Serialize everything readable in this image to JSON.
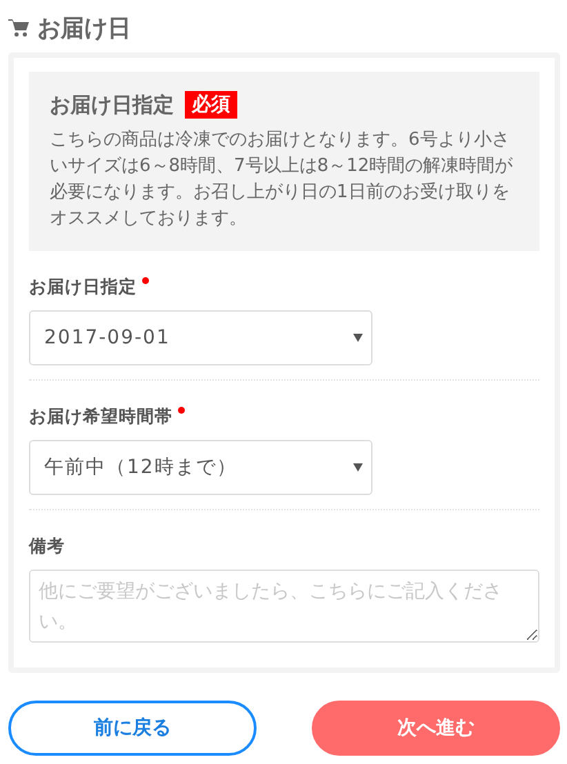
{
  "section": {
    "title": "お届け日"
  },
  "notice": {
    "title": "お届け日指定",
    "badge": "必須",
    "text": "こちらの商品は冷凍でのお届けとなります。6号より小さいサイズは6～8時間、7号以上は8～12時間の解凍時間が必要になります。お召し上がり日の1日前のお受け取りをオススメしております。"
  },
  "fields": [
    {
      "kind": "select",
      "label": "お届け日指定",
      "required": true,
      "value": "2017-09-01"
    },
    {
      "kind": "select",
      "label": "お届け希望時間帯",
      "required": true,
      "value": "午前中（12時まで）"
    },
    {
      "kind": "textarea",
      "label": "備考",
      "required": false,
      "placeholder": "他にご要望がございましたら、こちらにご記入ください。"
    }
  ],
  "buttons": [
    {
      "kind": "back",
      "label": "前に戻る"
    },
    {
      "kind": "next",
      "label": "次へ進む"
    }
  ]
}
